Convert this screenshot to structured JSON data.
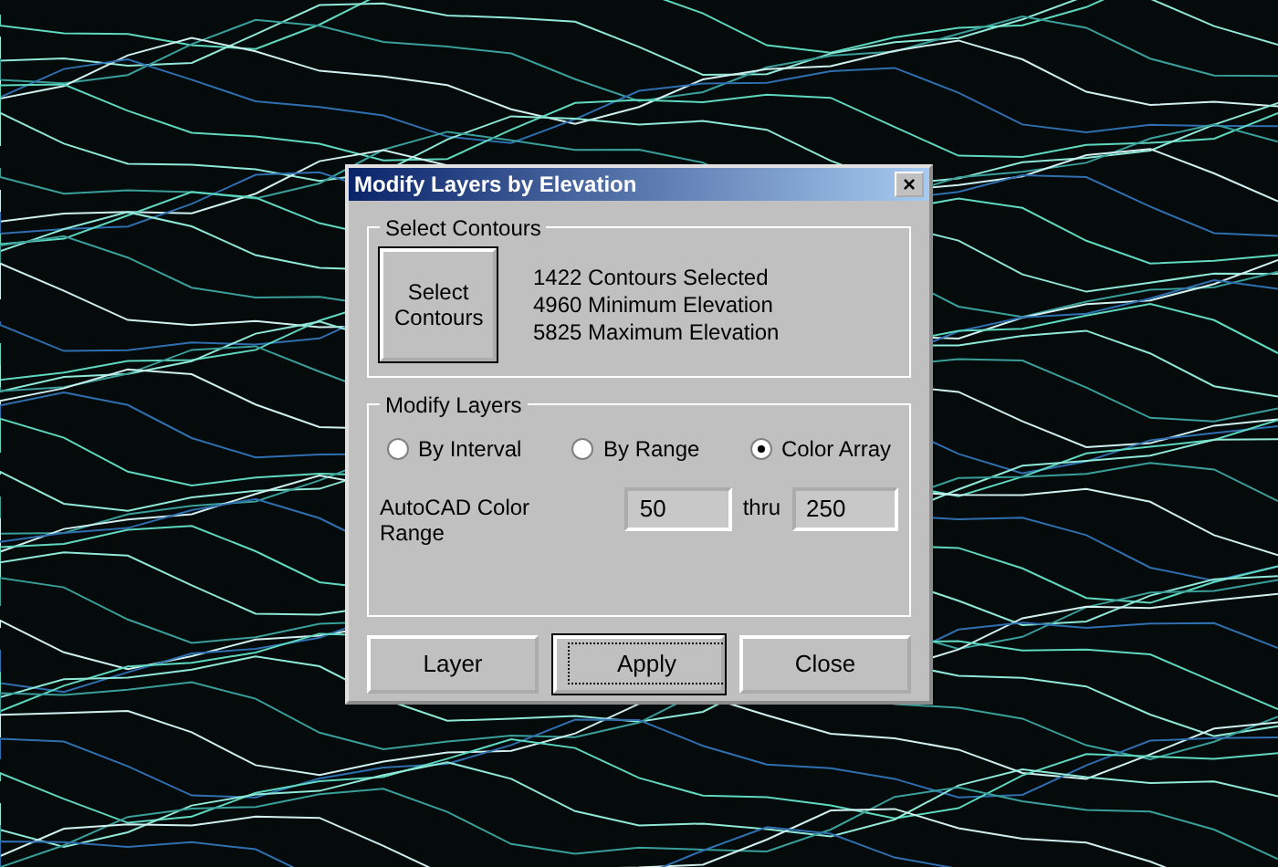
{
  "window": {
    "title": "Modify Layers by Elevation",
    "close": "×"
  },
  "select_contours": {
    "legend": "Select Contours",
    "button": "Select\nContours",
    "info": [
      "1422 Contours Selected",
      "4960 Minimum Elevation",
      "5825 Maximum Elevation"
    ]
  },
  "modify_layers": {
    "legend": "Modify Layers",
    "options": [
      {
        "label": "By Interval",
        "selected": false
      },
      {
        "label": "By Range",
        "selected": false
      },
      {
        "label": "Color Array",
        "selected": true
      }
    ],
    "range_label": "AutoCAD Color Range",
    "from": "50",
    "thru_label": "thru",
    "to": "250"
  },
  "buttons": [
    {
      "label": "Layer",
      "default": false
    },
    {
      "label": "Apply",
      "default": true
    },
    {
      "label": "Close",
      "default": false
    }
  ]
}
